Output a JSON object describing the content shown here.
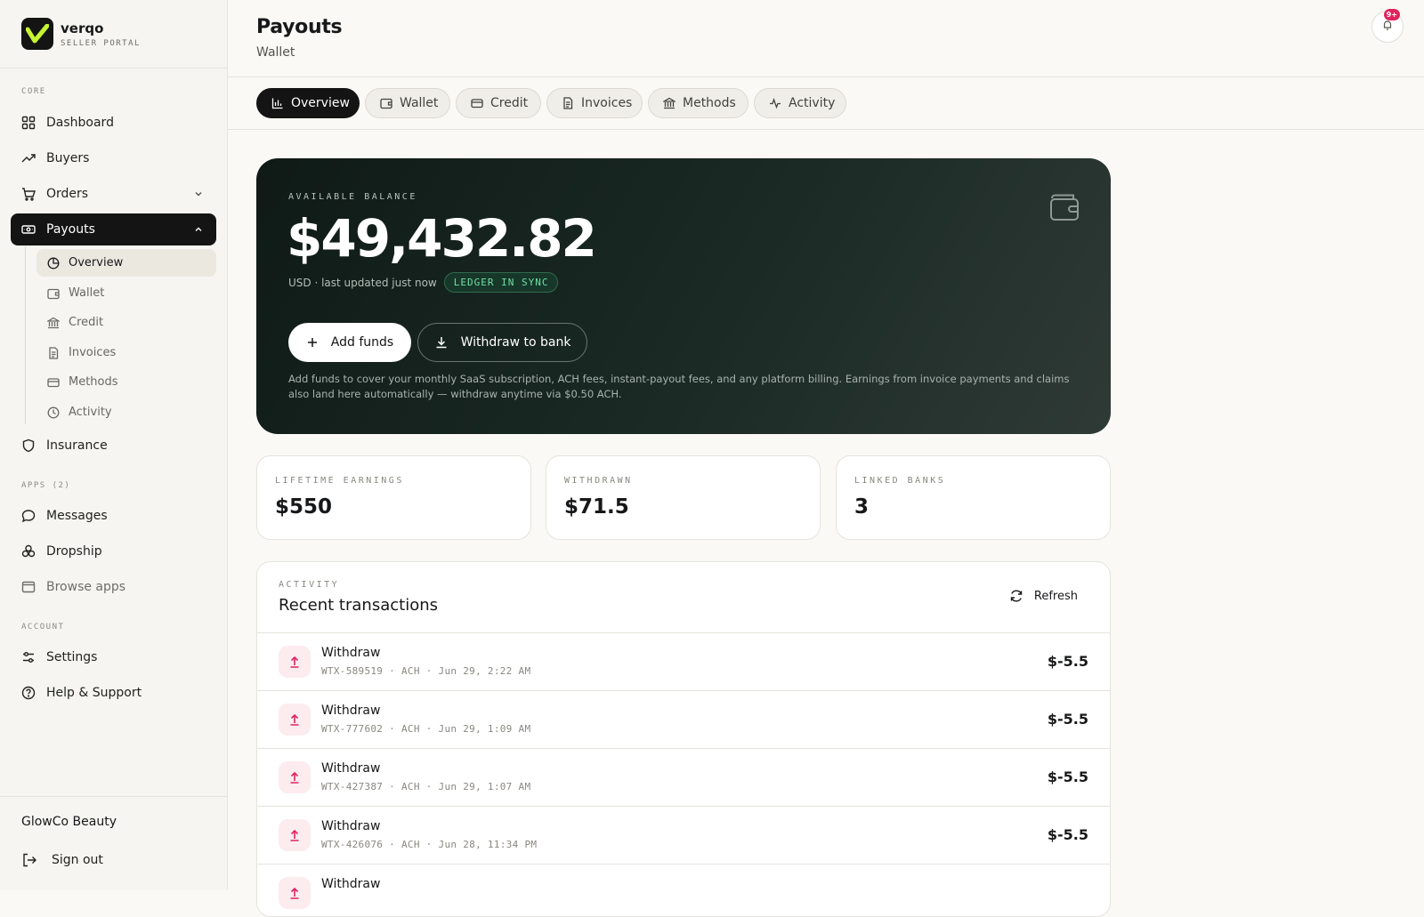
{
  "brand": {
    "name": "verqo",
    "subtitle": "SELLER PORTAL"
  },
  "sidebar": {
    "sections": {
      "core": "CORE",
      "apps": "APPS (2)",
      "account": "ACCOUNT"
    },
    "core_items": [
      {
        "label": "Dashboard",
        "icon": "grid-icon"
      },
      {
        "label": "Buyers",
        "icon": "trending-up-icon"
      },
      {
        "label": "Orders",
        "icon": "cart-icon"
      },
      {
        "label": "Payouts",
        "icon": "cash-icon"
      }
    ],
    "payout_subitems": [
      {
        "label": "Overview",
        "icon": "pie-chart-icon"
      },
      {
        "label": "Wallet",
        "icon": "wallet-icon"
      },
      {
        "label": "Credit",
        "icon": "bank-icon"
      },
      {
        "label": "Invoices",
        "icon": "document-icon"
      },
      {
        "label": "Methods",
        "icon": "card-icon"
      },
      {
        "label": "Activity",
        "icon": "clock-icon"
      }
    ],
    "insurance": "Insurance",
    "app_items": [
      {
        "label": "Messages",
        "icon": "message-icon"
      },
      {
        "label": "Dropship",
        "icon": "boxes-icon"
      },
      {
        "label": "Browse apps",
        "icon": "browser-icon"
      }
    ],
    "account_items": [
      {
        "label": "Settings",
        "icon": "sliders-icon"
      },
      {
        "label": "Help & Support",
        "icon": "help-icon"
      }
    ],
    "shop_name": "GlowCo Beauty",
    "sign_out": "Sign out"
  },
  "header": {
    "title": "Payouts",
    "subtitle": "Wallet",
    "notification_badge": "9+"
  },
  "tabs": [
    {
      "label": "Overview",
      "icon": "bar-chart-icon"
    },
    {
      "label": "Wallet",
      "icon": "wallet-icon"
    },
    {
      "label": "Credit",
      "icon": "card-icon"
    },
    {
      "label": "Invoices",
      "icon": "document-icon"
    },
    {
      "label": "Methods",
      "icon": "bank-icon"
    },
    {
      "label": "Activity",
      "icon": "pulse-icon"
    }
  ],
  "balance": {
    "label": "AVAILABLE BALANCE",
    "amount": "$49,432.82",
    "meta": "USD · last updated just now",
    "sync_badge": "LEDGER IN SYNC",
    "add_funds": "Add funds",
    "withdraw": "Withdraw to bank",
    "note": "Add funds to cover your monthly SaaS subscription, ACH fees, instant-payout fees, and any platform billing. Earnings from invoice payments and claims also land here automatically — withdraw anytime via $0.50 ACH."
  },
  "stats": [
    {
      "label": "LIFETIME EARNINGS",
      "value": "$550"
    },
    {
      "label": "WITHDRAWN",
      "value": "$71.5"
    },
    {
      "label": "LINKED BANKS",
      "value": "3"
    }
  ],
  "activity": {
    "label": "ACTIVITY",
    "title": "Recent transactions",
    "refresh": "Refresh",
    "transactions": [
      {
        "type": "Withdraw",
        "meta": "WTX-589519 · ACH · Jun 29, 2:22 AM",
        "amount": "$-5.5"
      },
      {
        "type": "Withdraw",
        "meta": "WTX-777602 · ACH · Jun 29, 1:09 AM",
        "amount": "$-5.5"
      },
      {
        "type": "Withdraw",
        "meta": "WTX-427387 · ACH · Jun 29, 1:07 AM",
        "amount": "$-5.5"
      },
      {
        "type": "Withdraw",
        "meta": "WTX-426076 · ACH · Jun 28, 11:34 PM",
        "amount": "$-5.5"
      },
      {
        "type": "Withdraw",
        "meta": "",
        "amount": ""
      }
    ]
  },
  "colors": {
    "accent_dark": "#141414",
    "brand_green": "#c6f432",
    "sync_green": "#6fe0a3",
    "withdraw_red": "#e0245e"
  }
}
